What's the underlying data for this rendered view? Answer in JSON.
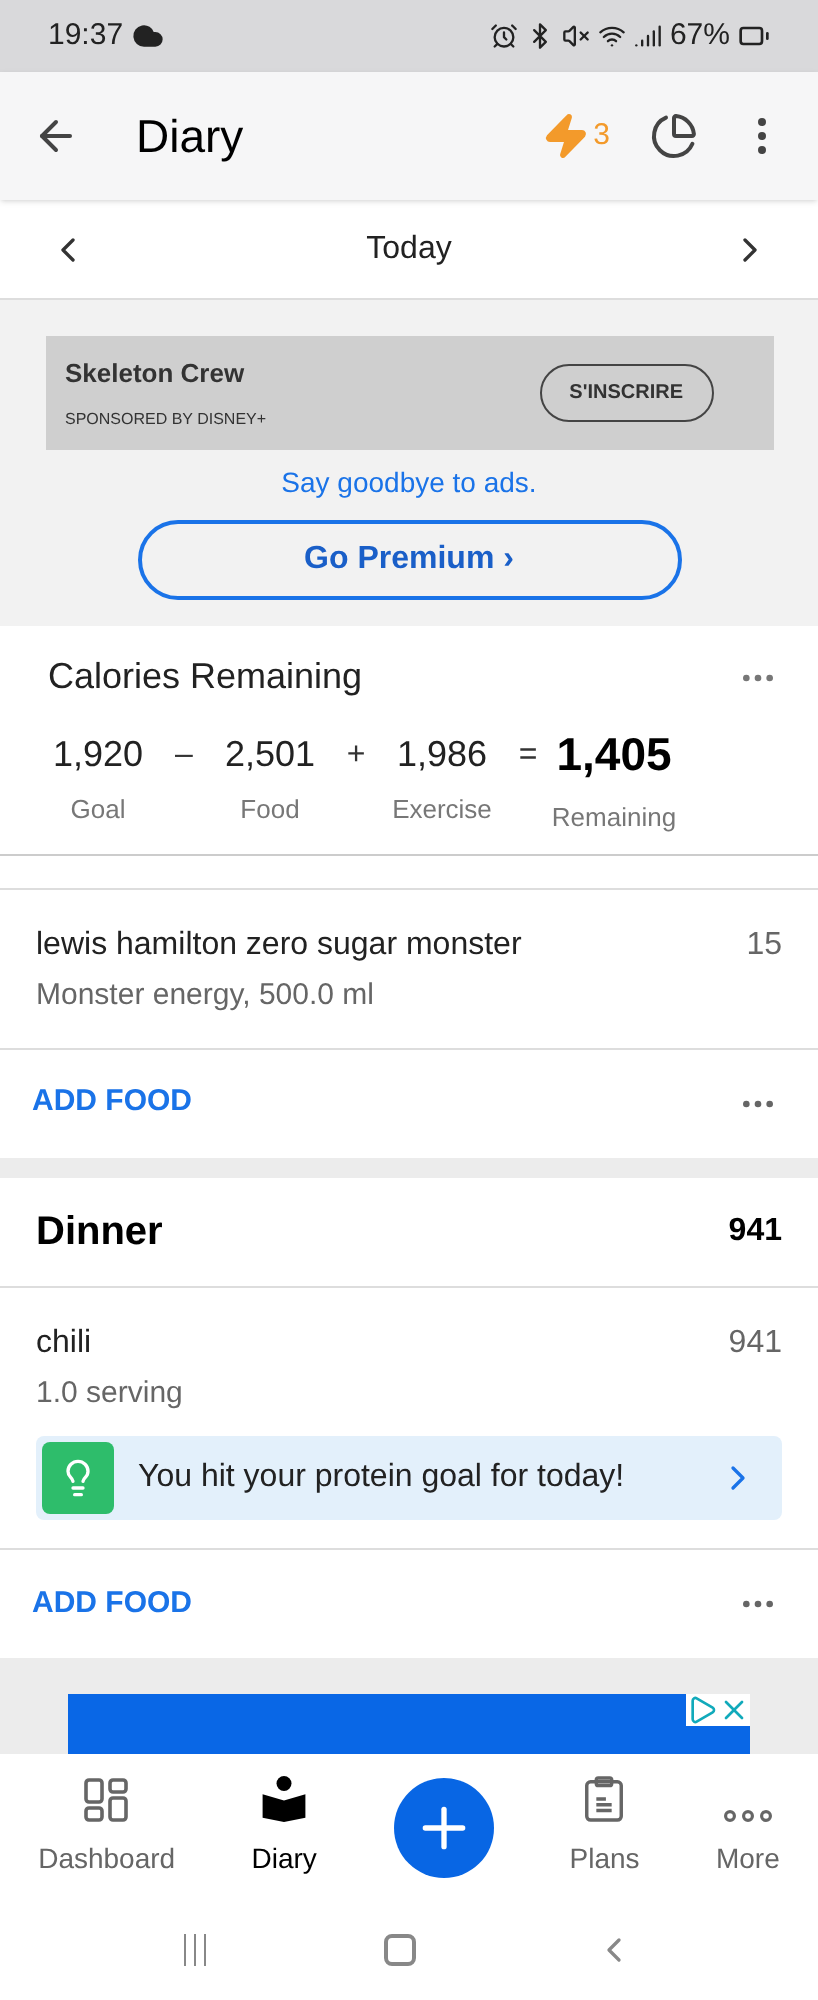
{
  "status_bar": {
    "time": "19:37",
    "battery": "67%"
  },
  "app_bar": {
    "title": "Diary",
    "streak": "3"
  },
  "date_nav": {
    "label": "Today"
  },
  "ad": {
    "title": "Skeleton Crew",
    "sponsor": "SPONSORED BY DISNEY+",
    "cta": "S'INSCRIRE"
  },
  "premium": {
    "text": "Say goodbye to ads.",
    "button": "Go Premium ›"
  },
  "calories": {
    "title": "Calories Remaining",
    "items": [
      {
        "value": "1,920",
        "label": "Goal",
        "op": "–"
      },
      {
        "value": "2,501",
        "label": "Food",
        "op": "+"
      },
      {
        "value": "1,986",
        "label": "Exercise",
        "op": "="
      },
      {
        "value": "1,405",
        "label": "Remaining"
      }
    ]
  },
  "meals": [
    {
      "entries": [
        {
          "name": "lewis hamilton zero sugar monster",
          "detail": "Monster energy, 500.0 ml",
          "calories": "15"
        }
      ],
      "add_label": "ADD FOOD"
    },
    {
      "name": "Dinner",
      "total": "941",
      "entries": [
        {
          "name": "chili",
          "detail": "1.0 serving",
          "calories": "941"
        }
      ],
      "tip": "You hit your protein goal for today!",
      "add_label": "ADD FOOD"
    }
  ],
  "bottom_nav": [
    {
      "label": "Dashboard",
      "selected": false,
      "kind": "dashboard"
    },
    {
      "label": "Diary",
      "selected": true,
      "kind": "diary"
    },
    {
      "kind": "add"
    },
    {
      "label": "Plans",
      "selected": false,
      "kind": "plans"
    },
    {
      "label": "More",
      "selected": false,
      "kind": "more"
    }
  ]
}
